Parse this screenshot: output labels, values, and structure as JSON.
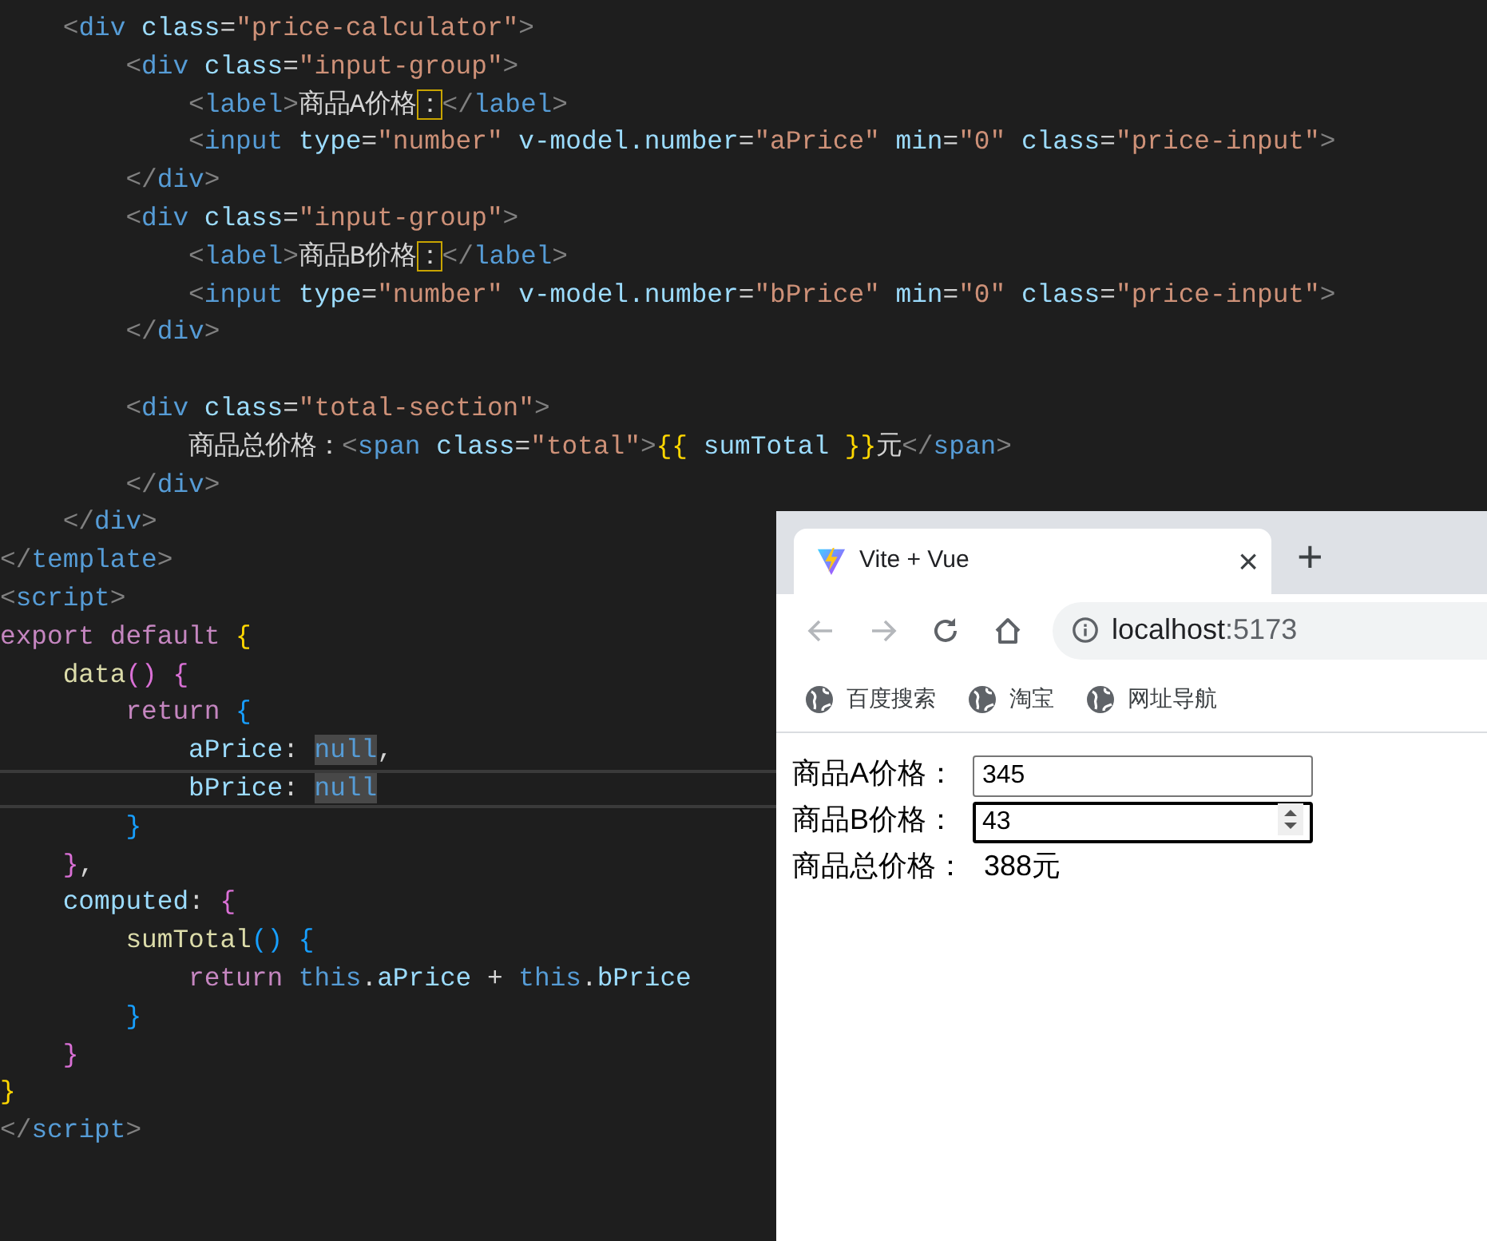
{
  "editor": {
    "lines": [
      {
        "current": false,
        "tokens": [
          {
            "t": "    <",
            "kind": "punct"
          },
          {
            "t": "div",
            "kind": "tag"
          },
          {
            "t": " class",
            "kind": "attr"
          },
          {
            "t": "=",
            "kind": "text"
          },
          {
            "t": "\"price-calculator\"",
            "kind": "str"
          },
          {
            "t": ">",
            "kind": "punct"
          }
        ]
      },
      {
        "current": false,
        "tokens": [
          {
            "t": "        <",
            "kind": "punct"
          },
          {
            "t": "div",
            "kind": "tag"
          },
          {
            "t": " class",
            "kind": "attr"
          },
          {
            "t": "=",
            "kind": "text"
          },
          {
            "t": "\"input-group\"",
            "kind": "str"
          },
          {
            "t": ">",
            "kind": "punct"
          }
        ]
      },
      {
        "current": false,
        "tokens": [
          {
            "t": "            <",
            "kind": "punct"
          },
          {
            "t": "label",
            "kind": "tag"
          },
          {
            "t": ">",
            "kind": "punct"
          },
          {
            "t": "商品A价格",
            "kind": "text"
          },
          {
            "t": "：",
            "kind": "ambiguous"
          },
          {
            "t": "</",
            "kind": "punct"
          },
          {
            "t": "label",
            "kind": "tag"
          },
          {
            "t": ">",
            "kind": "punct"
          }
        ]
      },
      {
        "current": false,
        "tokens": [
          {
            "t": "            <",
            "kind": "punct"
          },
          {
            "t": "input",
            "kind": "tag"
          },
          {
            "t": " type",
            "kind": "attr"
          },
          {
            "t": "=",
            "kind": "text"
          },
          {
            "t": "\"number\"",
            "kind": "str"
          },
          {
            "t": " v-model.number",
            "kind": "attr"
          },
          {
            "t": "=",
            "kind": "text"
          },
          {
            "t": "\"aPrice\"",
            "kind": "str"
          },
          {
            "t": " min",
            "kind": "attr"
          },
          {
            "t": "=",
            "kind": "text"
          },
          {
            "t": "\"0\"",
            "kind": "str"
          },
          {
            "t": " class",
            "kind": "attr"
          },
          {
            "t": "=",
            "kind": "text"
          },
          {
            "t": "\"price-input\"",
            "kind": "str"
          },
          {
            "t": ">",
            "kind": "punct"
          }
        ]
      },
      {
        "current": false,
        "tokens": [
          {
            "t": "        </",
            "kind": "punct"
          },
          {
            "t": "div",
            "kind": "tag"
          },
          {
            "t": ">",
            "kind": "punct"
          }
        ]
      },
      {
        "current": false,
        "tokens": [
          {
            "t": "        <",
            "kind": "punct"
          },
          {
            "t": "div",
            "kind": "tag"
          },
          {
            "t": " class",
            "kind": "attr"
          },
          {
            "t": "=",
            "kind": "text"
          },
          {
            "t": "\"input-group\"",
            "kind": "str"
          },
          {
            "t": ">",
            "kind": "punct"
          }
        ]
      },
      {
        "current": false,
        "tokens": [
          {
            "t": "            <",
            "kind": "punct"
          },
          {
            "t": "label",
            "kind": "tag"
          },
          {
            "t": ">",
            "kind": "punct"
          },
          {
            "t": "商品B价格",
            "kind": "text"
          },
          {
            "t": "：",
            "kind": "ambiguous"
          },
          {
            "t": "</",
            "kind": "punct"
          },
          {
            "t": "label",
            "kind": "tag"
          },
          {
            "t": ">",
            "kind": "punct"
          }
        ]
      },
      {
        "current": false,
        "tokens": [
          {
            "t": "            <",
            "kind": "punct"
          },
          {
            "t": "input",
            "kind": "tag"
          },
          {
            "t": " type",
            "kind": "attr"
          },
          {
            "t": "=",
            "kind": "text"
          },
          {
            "t": "\"number\"",
            "kind": "str"
          },
          {
            "t": " v-model.number",
            "kind": "attr"
          },
          {
            "t": "=",
            "kind": "text"
          },
          {
            "t": "\"bPrice\"",
            "kind": "str"
          },
          {
            "t": " min",
            "kind": "attr"
          },
          {
            "t": "=",
            "kind": "text"
          },
          {
            "t": "\"0\"",
            "kind": "str"
          },
          {
            "t": " class",
            "kind": "attr"
          },
          {
            "t": "=",
            "kind": "text"
          },
          {
            "t": "\"price-input\"",
            "kind": "str"
          },
          {
            "t": ">",
            "kind": "punct"
          }
        ]
      },
      {
        "current": false,
        "tokens": [
          {
            "t": "        </",
            "kind": "punct"
          },
          {
            "t": "div",
            "kind": "tag"
          },
          {
            "t": ">",
            "kind": "punct"
          }
        ]
      },
      {
        "current": false
      },
      {
        "current": false,
        "tokens": [
          {
            "t": "        <",
            "kind": "punct"
          },
          {
            "t": "div",
            "kind": "tag"
          },
          {
            "t": " class",
            "kind": "attr"
          },
          {
            "t": "=",
            "kind": "text"
          },
          {
            "t": "\"total-section\"",
            "kind": "str"
          },
          {
            "t": ">",
            "kind": "punct"
          }
        ]
      },
      {
        "current": false,
        "tokens": [
          {
            "t": "            商品总价格：",
            "kind": "text"
          },
          {
            "t": "<",
            "kind": "punct"
          },
          {
            "t": "span",
            "kind": "tag"
          },
          {
            "t": " class",
            "kind": "attr"
          },
          {
            "t": "=",
            "kind": "text"
          },
          {
            "t": "\"total\"",
            "kind": "str"
          },
          {
            "t": ">",
            "kind": "punct"
          },
          {
            "t": "{{",
            "kind": "brace1"
          },
          {
            "t": " sumTotal ",
            "kind": "prop"
          },
          {
            "t": "}}",
            "kind": "brace1"
          },
          {
            "t": "元",
            "kind": "text"
          },
          {
            "t": "</",
            "kind": "punct"
          },
          {
            "t": "span",
            "kind": "tag"
          },
          {
            "t": ">",
            "kind": "punct"
          }
        ]
      },
      {
        "current": false,
        "tokens": [
          {
            "t": "        </",
            "kind": "punct"
          },
          {
            "t": "div",
            "kind": "tag"
          },
          {
            "t": ">",
            "kind": "punct"
          }
        ]
      },
      {
        "current": false,
        "tokens": [
          {
            "t": "    </",
            "kind": "punct"
          },
          {
            "t": "div",
            "kind": "tag"
          },
          {
            "t": ">",
            "kind": "punct"
          }
        ]
      },
      {
        "current": false,
        "tokens": [
          {
            "t": "</",
            "kind": "punct"
          },
          {
            "t": "template",
            "kind": "tag"
          },
          {
            "t": ">",
            "kind": "punct"
          }
        ]
      },
      {
        "current": false,
        "tokens": [
          {
            "t": "<",
            "kind": "punct"
          },
          {
            "t": "script",
            "kind": "tag"
          },
          {
            "t": ">",
            "kind": "punct"
          }
        ]
      },
      {
        "current": false,
        "tokens": [
          {
            "t": "export default ",
            "kind": "kw"
          },
          {
            "t": "{",
            "kind": "brace1"
          }
        ]
      },
      {
        "current": false,
        "tokens": [
          {
            "t": "    data",
            "kind": "func"
          },
          {
            "t": "() {",
            "kind": "brace2"
          }
        ]
      },
      {
        "current": false,
        "tokens": [
          {
            "t": "        return ",
            "kind": "kw"
          },
          {
            "t": "{",
            "kind": "brace3"
          }
        ]
      },
      {
        "current": false,
        "tokens": [
          {
            "t": "            aPrice",
            "kind": "prop"
          },
          {
            "t": ": ",
            "kind": "text"
          },
          {
            "t": "null",
            "kind": "occurrence"
          },
          {
            "t": ",",
            "kind": "text"
          }
        ]
      },
      {
        "current": true,
        "tokens": [
          {
            "t": "            bPrice",
            "kind": "prop"
          },
          {
            "t": ": ",
            "kind": "text"
          },
          {
            "t": "null",
            "kind": "occurrence"
          }
        ]
      },
      {
        "current": false,
        "tokens": [
          {
            "t": "        }",
            "kind": "brace3"
          }
        ]
      },
      {
        "current": false,
        "tokens": [
          {
            "t": "    }",
            "kind": "brace2"
          },
          {
            "t": ",",
            "kind": "text"
          }
        ]
      },
      {
        "current": false,
        "tokens": [
          {
            "t": "    computed",
            "kind": "prop"
          },
          {
            "t": ": ",
            "kind": "text"
          },
          {
            "t": "{",
            "kind": "brace2"
          }
        ]
      },
      {
        "current": false,
        "tokens": [
          {
            "t": "        sumTotal",
            "kind": "func"
          },
          {
            "t": "() {",
            "kind": "brace3"
          }
        ]
      },
      {
        "current": false,
        "tokens": [
          {
            "t": "            return ",
            "kind": "kw"
          },
          {
            "t": "this",
            "kind": "const"
          },
          {
            "t": ".",
            "kind": "text"
          },
          {
            "t": "aPrice",
            "kind": "prop"
          },
          {
            "t": " + ",
            "kind": "text"
          },
          {
            "t": "this",
            "kind": "const"
          },
          {
            "t": ".",
            "kind": "text"
          },
          {
            "t": "bPrice",
            "kind": "prop"
          }
        ]
      },
      {
        "current": false,
        "tokens": [
          {
            "t": "        }",
            "kind": "brace3"
          }
        ]
      },
      {
        "current": false,
        "tokens": [
          {
            "t": "    }",
            "kind": "brace2"
          }
        ]
      },
      {
        "current": false,
        "tokens": [
          {
            "t": "}",
            "kind": "brace1"
          }
        ]
      },
      {
        "current": false,
        "tokens": [
          {
            "t": "</",
            "kind": "punct"
          },
          {
            "t": "script",
            "kind": "tag"
          },
          {
            "t": ">",
            "kind": "punct"
          }
        ]
      }
    ]
  },
  "browser": {
    "tab": {
      "title": "Vite + Vue",
      "close": "×"
    },
    "new_tab": "+",
    "nav_buttons": [
      {
        "kind": "back",
        "disabled": true
      },
      {
        "kind": "forward",
        "disabled": true
      },
      {
        "kind": "reload",
        "disabled": false
      },
      {
        "kind": "home",
        "disabled": false
      }
    ],
    "address": {
      "host": "localhost",
      "port": ":5173"
    },
    "bookmarks": [
      {
        "label": "百度搜索"
      },
      {
        "label": "淘宝"
      },
      {
        "label": "网址导航"
      }
    ],
    "page": {
      "fields": [
        {
          "label": "商品A价格：",
          "value": "345",
          "focused": false
        },
        {
          "label": "商品B价格：",
          "value": "43",
          "focused": true
        }
      ],
      "total_label": "商品总价格：",
      "total_value": "388元"
    }
  }
}
